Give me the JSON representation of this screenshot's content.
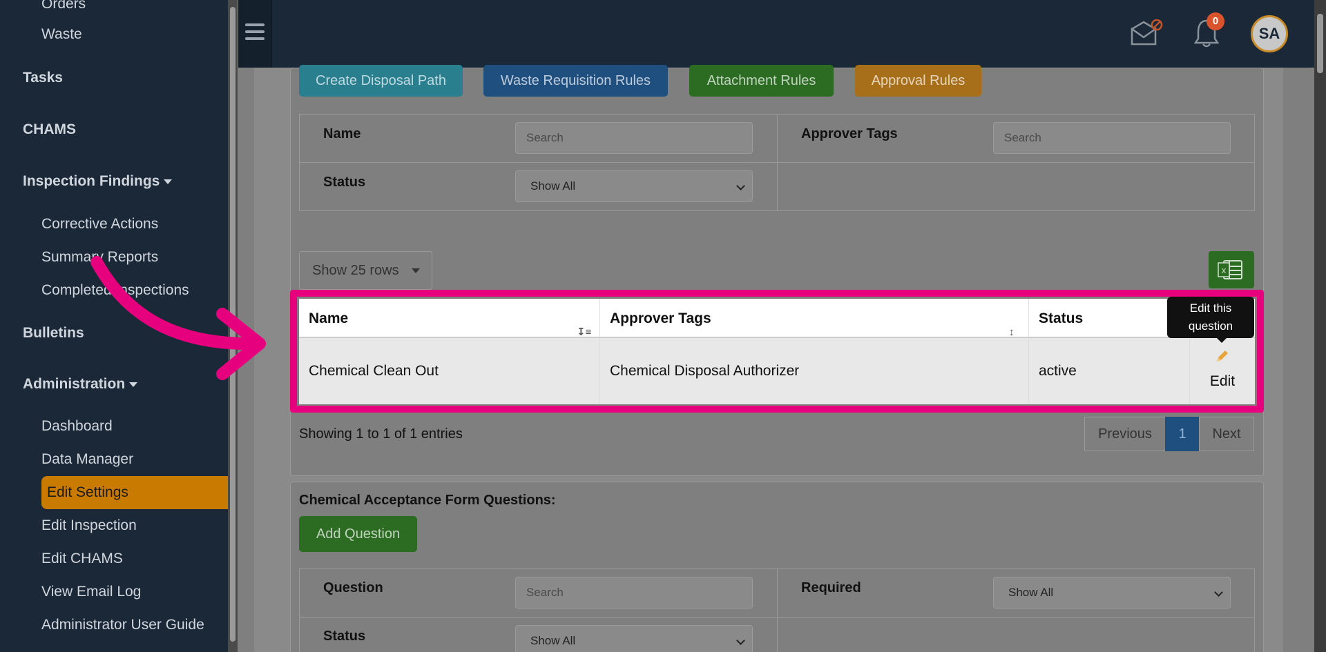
{
  "sidebar": {
    "items": [
      {
        "label": "Orders",
        "type": "sub"
      },
      {
        "label": "Waste",
        "type": "sub"
      },
      {
        "label": "Tasks",
        "type": "main"
      },
      {
        "label": "CHAMS",
        "type": "main"
      },
      {
        "label": "Inspection Findings",
        "type": "main"
      },
      {
        "label": "Corrective Actions",
        "type": "sub"
      },
      {
        "label": "Summary Reports",
        "type": "sub"
      },
      {
        "label": "Completed Inspections",
        "type": "sub"
      },
      {
        "label": "Bulletins",
        "type": "main"
      },
      {
        "label": "Administration",
        "type": "main"
      },
      {
        "label": "Dashboard",
        "type": "sub"
      },
      {
        "label": "Data Manager",
        "type": "sub"
      },
      {
        "label": "Edit Settings",
        "type": "sub",
        "active": true
      },
      {
        "label": "Edit Inspection",
        "type": "sub"
      },
      {
        "label": "Edit CHAMS",
        "type": "sub"
      },
      {
        "label": "View Email Log",
        "type": "sub"
      },
      {
        "label": "Administrator User Guide",
        "type": "sub"
      }
    ]
  },
  "topbar": {
    "notification_count": "0",
    "avatar_initials": "SA"
  },
  "toolbar": {
    "create_disposal_path": "Create Disposal Path",
    "waste_requisition_rules": "Waste Requisition Rules",
    "attachment_rules": "Attachment Rules",
    "approval_rules": "Approval Rules"
  },
  "filters": {
    "name_label": "Name",
    "name_placeholder": "Search",
    "approver_tags_label": "Approver Tags",
    "approver_tags_placeholder": "Search",
    "status_label": "Status",
    "status_value": "Show All"
  },
  "table": {
    "rows_select": "Show 25 rows",
    "columns": [
      "Name",
      "Approver Tags",
      "Status"
    ],
    "rows": [
      {
        "name": "Chemical Clean Out",
        "approver_tags": "Chemical Disposal Authorizer",
        "status": "active",
        "action": "Edit"
      }
    ],
    "tooltip": "Edit this question",
    "showing": "Showing 1 to 1 of 1 entries",
    "pager": {
      "previous": "Previous",
      "page": "1",
      "next": "Next"
    }
  },
  "questions_section": {
    "title": "Chemical Acceptance Form Questions:",
    "add_button": "Add Question",
    "question_label": "Question",
    "question_placeholder": "Search",
    "required_label": "Required",
    "required_value": "Show All",
    "status_label": "Status",
    "status_value": "Show All"
  },
  "colors": {
    "sidebar_bg": "#1b2837",
    "active_item": "#c97a00",
    "highlight": "#e6007e"
  }
}
